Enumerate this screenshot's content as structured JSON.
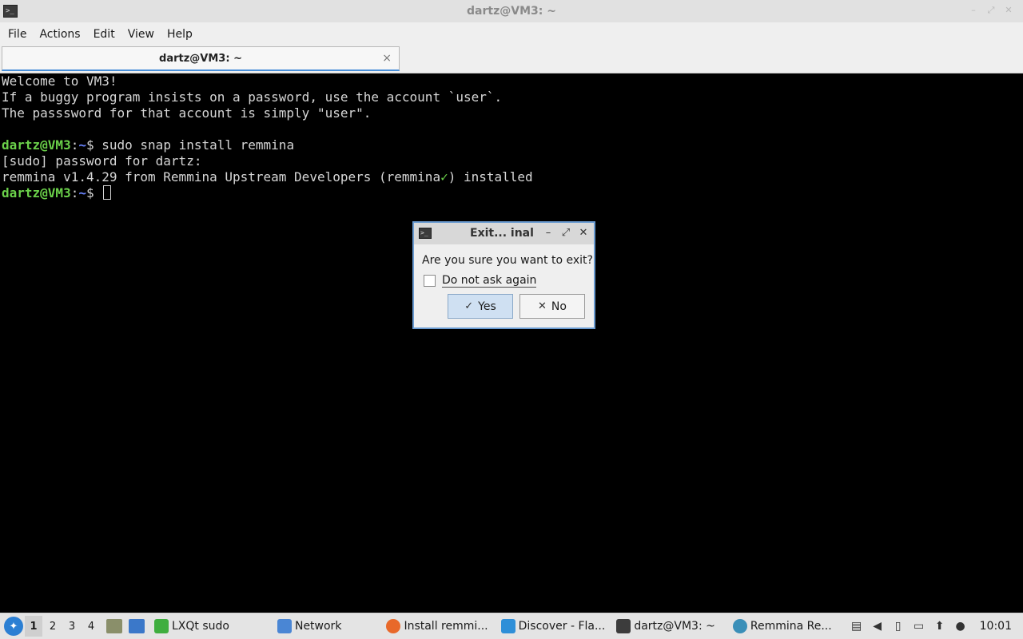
{
  "window": {
    "title": "dartz@VM3: ~"
  },
  "menubar": {
    "items": [
      "File",
      "Actions",
      "Edit",
      "View",
      "Help"
    ]
  },
  "tabs": [
    {
      "label": "dartz@VM3: ~",
      "close": "×"
    }
  ],
  "terminal": {
    "line1": "Welcome to VM3!",
    "line2": "If a buggy program insists on a password, use the account `user`.",
    "line3": "The passsword for that account is simply \"user\".",
    "prompt_user": "dartz@VM3",
    "prompt_sep": ":",
    "prompt_path": "~",
    "prompt_symbol": "$ ",
    "command1": "sudo snap install remmina",
    "line5": "[sudo] password for dartz:",
    "line6a": "remmina v1.4.29 from Remmina Upstream Developers (remmina",
    "line6check": "✓",
    "line6b": ") installed"
  },
  "dialog": {
    "title": "Exit... inal",
    "question": "Are you sure you want to exit?",
    "checkbox_label": "Do not ask again",
    "checkbox_checked": false,
    "yes_label": "Yes",
    "no_label": "No",
    "yes_icon": "✓",
    "no_icon": "✕"
  },
  "taskbar": {
    "desktops": [
      "1",
      "2",
      "3",
      "4"
    ],
    "active_desktop": "1",
    "tasks": [
      {
        "label": "LXQt sudo",
        "icon": "shield-icon",
        "color": "#3fae3f"
      },
      {
        "label": "Network",
        "icon": "folder-icon",
        "color": "#4a86d4"
      },
      {
        "label": "Install remmi...",
        "icon": "firefox-icon",
        "color": "#e8692a"
      },
      {
        "label": "Discover - Fla...",
        "icon": "discover-icon",
        "color": "#2e8fd8"
      },
      {
        "label": "dartz@VM3: ~",
        "icon": "terminal-icon",
        "color": "#3c3c3c"
      },
      {
        "label": "Remmina Re...",
        "icon": "remmina-icon",
        "color": "#3a8fb8"
      }
    ],
    "clock": "10:01"
  }
}
